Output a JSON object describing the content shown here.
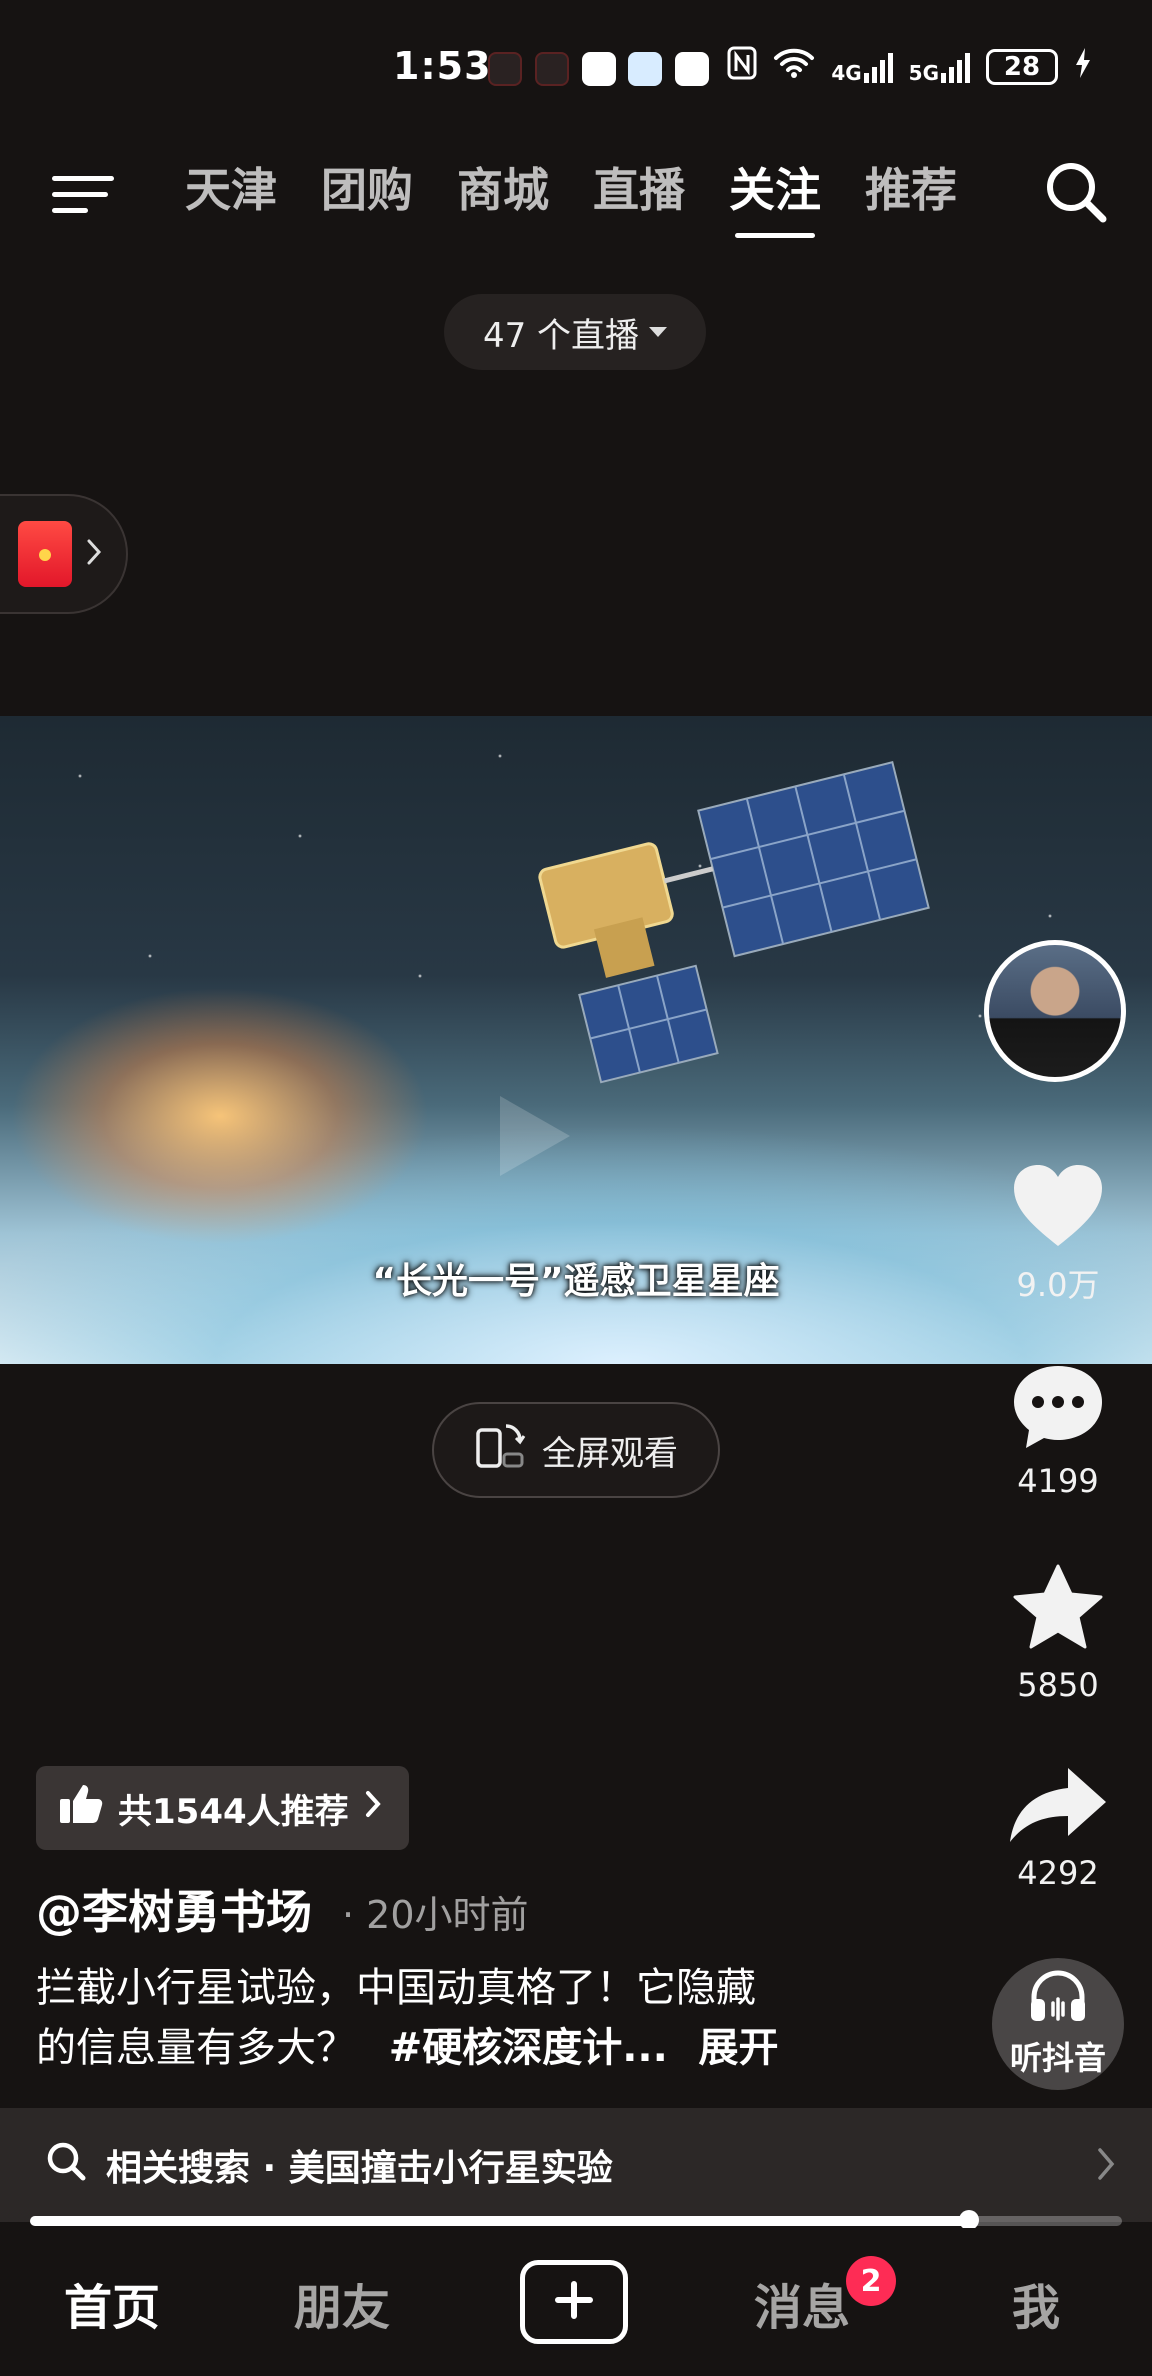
{
  "status_bar": {
    "time": "1:53",
    "network_4g": "4G",
    "network_5g": "5G",
    "battery": "28"
  },
  "top_nav": {
    "tabs": [
      {
        "label": "天津",
        "active": false
      },
      {
        "label": "团购",
        "active": false
      },
      {
        "label": "商城",
        "active": false
      },
      {
        "label": "直播",
        "active": false
      },
      {
        "label": "关注",
        "active": true
      },
      {
        "label": "推荐",
        "active": false
      }
    ]
  },
  "live_pill": "47 个直播",
  "video": {
    "subtitle": "“长光一号”遥感卫星星座",
    "fullscreen_label": "全屏观看"
  },
  "rail": {
    "likes": "9.0万",
    "comments": "4199",
    "favorites": "5850",
    "shares": "4292",
    "listen_label": "听抖音"
  },
  "post": {
    "recommend": "共1544人推荐",
    "author": "@李树勇书场",
    "time_ago": "20小时前",
    "desc_line1": "拦截小行星试验，中国动真格了！它隐藏",
    "desc_line2_text": "的信息量有多大？",
    "desc_tag": "#硬核深度计...",
    "desc_expand": "展开"
  },
  "related_search": "相关搜索 · 美国撞击小行星实验",
  "playback_progress": 0.86,
  "bottom_nav": {
    "home": "首页",
    "friends": "朋友",
    "messages": "消息",
    "messages_badge": "2",
    "me": "我"
  },
  "colors": {
    "background": "#161312",
    "accent_badge": "#fe2c55"
  }
}
